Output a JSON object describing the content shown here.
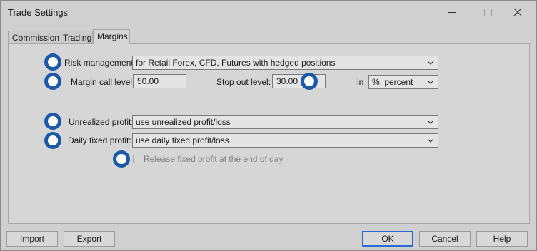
{
  "window": {
    "title": "Trade Settings"
  },
  "tabs": [
    {
      "label": "Commissions",
      "active": false
    },
    {
      "label": "Trading",
      "active": false
    },
    {
      "label": "Margins",
      "active": true
    }
  ],
  "margins": {
    "risk_management": {
      "label": "Risk management:",
      "value": "for Retail Forex, CFD, Futures with hedged positions"
    },
    "margin_call": {
      "label": "Margin call level:",
      "value": "50.00"
    },
    "stop_out": {
      "label": "Stop out level:",
      "value": "30.00"
    },
    "unit": {
      "label": "in",
      "value": "%, percent"
    },
    "unrealized_profit": {
      "label": "Unrealized profit:",
      "value": "use unrealized profit/loss"
    },
    "daily_fixed_profit": {
      "label": "Daily fixed profit:",
      "value": "use daily fixed profit/loss"
    },
    "release_fixed_profit": {
      "label": "Release fixed profit at the end of day",
      "checked": false
    }
  },
  "buttons": {
    "import": "Import",
    "export": "Export",
    "ok": "OK",
    "cancel": "Cancel",
    "help": "Help"
  },
  "colors": {
    "marker": "#1c5aa8",
    "default_button_border": "#2a6ad6"
  }
}
